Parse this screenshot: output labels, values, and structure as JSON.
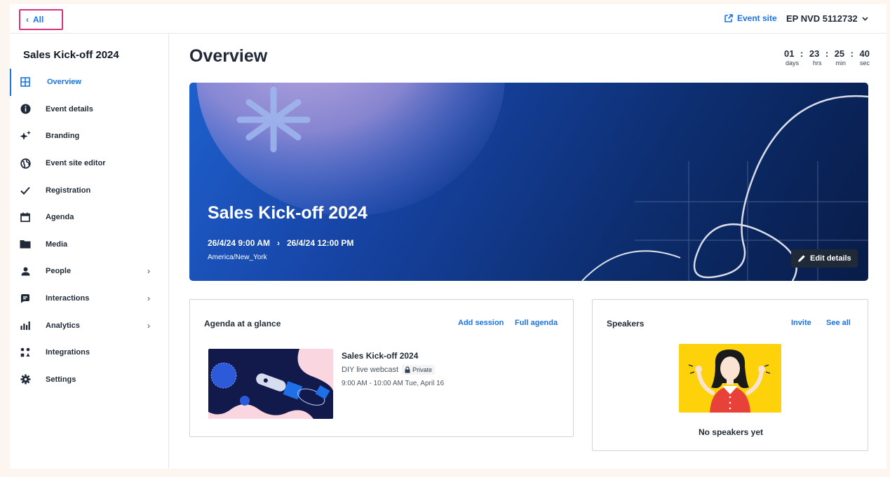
{
  "topbar": {
    "back_label": "All",
    "event_site_label": "Event site",
    "account_label": "EP NVD 5112732"
  },
  "sidebar": {
    "event_name": "Sales Kick-off 2024",
    "items": [
      {
        "label": "Overview",
        "icon": "grid-icon",
        "active": true
      },
      {
        "label": "Event details",
        "icon": "info-icon"
      },
      {
        "label": "Branding",
        "icon": "sparkle-icon"
      },
      {
        "label": "Event site editor",
        "icon": "globe-icon"
      },
      {
        "label": "Registration",
        "icon": "check-icon"
      },
      {
        "label": "Agenda",
        "icon": "calendar-icon"
      },
      {
        "label": "Media",
        "icon": "folder-icon"
      },
      {
        "label": "People",
        "icon": "person-icon",
        "expandable": true
      },
      {
        "label": "Interactions",
        "icon": "chat-icon",
        "expandable": true
      },
      {
        "label": "Analytics",
        "icon": "bar-chart-icon",
        "expandable": true
      },
      {
        "label": "Integrations",
        "icon": "integrations-icon"
      },
      {
        "label": "Settings",
        "icon": "gear-icon"
      }
    ]
  },
  "main": {
    "title": "Overview",
    "countdown": {
      "days": "01",
      "hrs": "23",
      "min": "25",
      "sec": "40",
      "sep": ":",
      "days_label": "days",
      "hrs_label": "hrs",
      "min_label": "min",
      "sec_label": "sec"
    },
    "hero": {
      "title": "Sales Kick-off 2024",
      "start": "26/4/24 9:00 AM",
      "end": "26/4/24 12:00 PM",
      "timezone": "America/New_York",
      "edit_label": "Edit details"
    },
    "agenda": {
      "title": "Agenda at a glance",
      "add_session_label": "Add session",
      "full_agenda_label": "Full agenda",
      "session": {
        "title": "Sales Kick-off 2024",
        "type": "DIY live webcast",
        "privacy": "Private",
        "time": "9:00 AM - 10:00 AM Tue, April 16"
      }
    },
    "speakers": {
      "title": "Speakers",
      "invite_label": "Invite",
      "see_all_label": "See all",
      "empty_text": "No speakers yet"
    }
  },
  "colors": {
    "accent": "#1a73e8",
    "highlight": "#d6337e",
    "speaker_bg": "#fdd20a",
    "page_bg": "#fdf5ef"
  }
}
